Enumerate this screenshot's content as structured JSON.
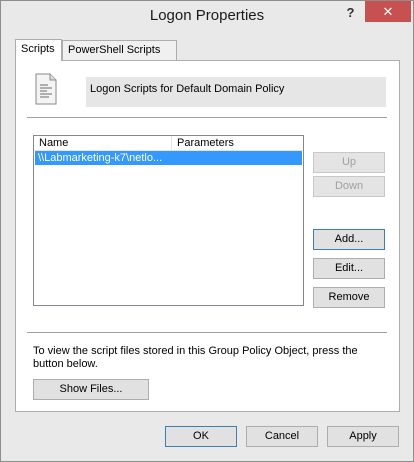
{
  "window": {
    "title": "Logon Properties",
    "help_glyph": "?",
    "close_glyph": "✕"
  },
  "tabs": [
    {
      "label": "Scripts"
    },
    {
      "label": "PowerShell Scripts"
    }
  ],
  "header": {
    "text": "Logon Scripts for Default Domain Policy"
  },
  "list": {
    "columns": [
      "Name",
      "Parameters"
    ],
    "rows": [
      {
        "name": "\\\\Labmarketing-k7\\netlo...",
        "params": ""
      }
    ]
  },
  "side_buttons": {
    "up": "Up",
    "down": "Down",
    "add": "Add...",
    "edit": "Edit...",
    "remove": "Remove"
  },
  "note": "To view the script files stored in this Group Policy Object, press the button below.",
  "show_files_label": "Show Files...",
  "footer": {
    "ok": "OK",
    "cancel": "Cancel",
    "apply": "Apply"
  },
  "colors": {
    "selection": "#3399ff",
    "close_button": "#c75050"
  }
}
